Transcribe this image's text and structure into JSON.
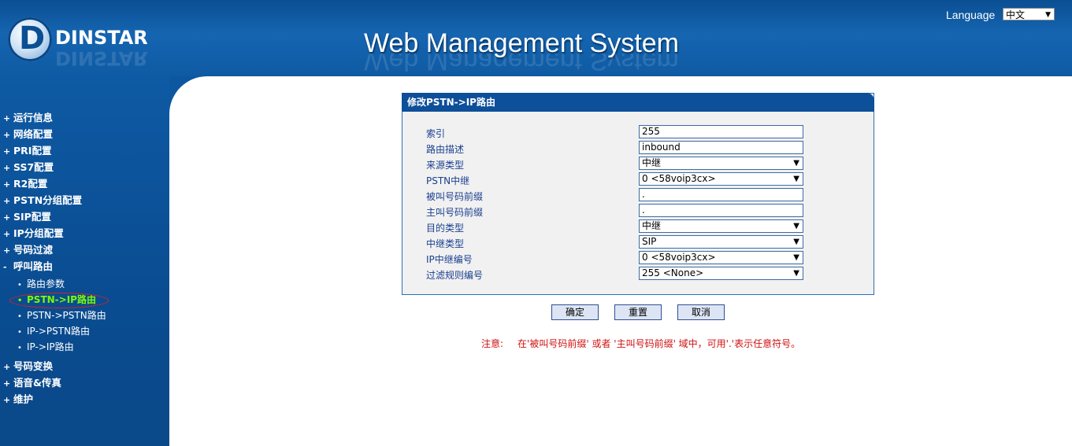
{
  "header": {
    "brand": "DINSTAR",
    "title": "Web Management System",
    "language_label": "Language",
    "language_value": "中文"
  },
  "sidebar": {
    "items": [
      {
        "label": "运行信息",
        "mark": "+"
      },
      {
        "label": "网络配置",
        "mark": "+"
      },
      {
        "label": "PRI配置",
        "mark": "+"
      },
      {
        "label": "SS7配置",
        "mark": "+"
      },
      {
        "label": "R2配置",
        "mark": "+"
      },
      {
        "label": "PSTN分组配置",
        "mark": "+"
      },
      {
        "label": "SIP配置",
        "mark": "+"
      },
      {
        "label": "IP分组配置",
        "mark": "+"
      },
      {
        "label": "号码过滤",
        "mark": "+"
      },
      {
        "label": "呼叫路由",
        "mark": "-"
      }
    ],
    "subitems": [
      {
        "label": "路由参数"
      },
      {
        "label": "PSTN->IP路由"
      },
      {
        "label": "PSTN->PSTN路由"
      },
      {
        "label": "IP->PSTN路由"
      },
      {
        "label": "IP->IP路由"
      }
    ],
    "items_after": [
      {
        "label": "号码变换",
        "mark": "+"
      },
      {
        "label": "语音&传真",
        "mark": "+"
      },
      {
        "label": "维护",
        "mark": "+"
      }
    ]
  },
  "panel": {
    "title": "修改PSTN->IP路由",
    "fields": [
      {
        "label": "索引",
        "value": "255",
        "type": "input"
      },
      {
        "label": "路由描述",
        "value": "inbound",
        "type": "input"
      },
      {
        "label": "来源类型",
        "value": "中继",
        "type": "select"
      },
      {
        "label": "PSTN中继",
        "value": "0 <58voip3cx>",
        "type": "select"
      },
      {
        "label": "被叫号码前缀",
        "value": ".",
        "type": "input"
      },
      {
        "label": "主叫号码前缀",
        "value": ".",
        "type": "input"
      },
      {
        "label": "目的类型",
        "value": "中继",
        "type": "select"
      },
      {
        "label": "中继类型",
        "value": "SIP",
        "type": "select"
      },
      {
        "label": "IP中继编号",
        "value": "0 <58voip3cx>",
        "type": "select"
      },
      {
        "label": "过滤规则编号",
        "value": "255 <None>",
        "type": "select"
      }
    ]
  },
  "buttons": {
    "confirm": "确定",
    "reset": "重置",
    "cancel": "取消"
  },
  "note": {
    "prefix": "注意:",
    "text": "在'被叫号码前缀' 或者 '主叫号码前缀' 域中，可用'.'表示任意符号。"
  },
  "colors": {
    "header_blue": "#1565b1",
    "sidebar_blue": "#0a4c91",
    "active_green": "#7cfc00",
    "note_red": "#d01010"
  }
}
